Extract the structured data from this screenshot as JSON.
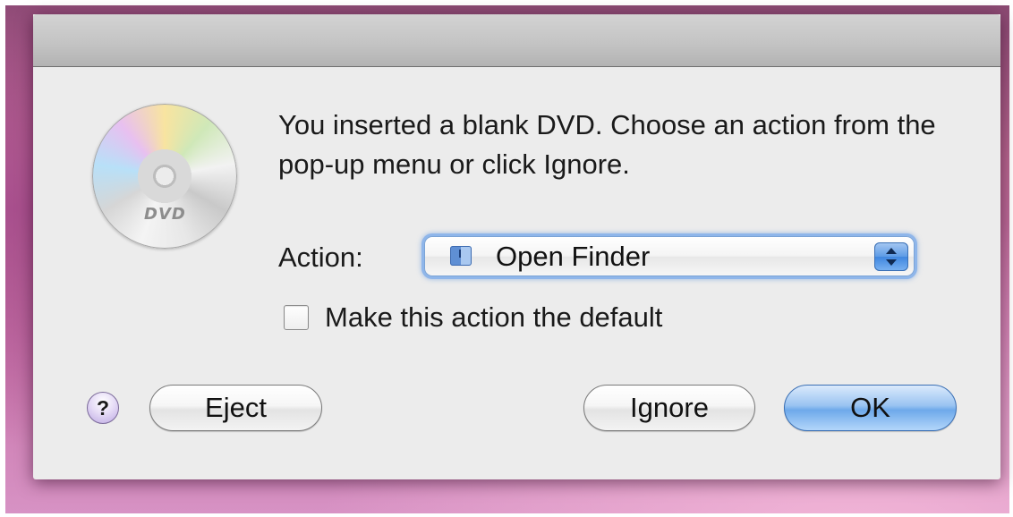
{
  "dialog": {
    "message": "You inserted a blank DVD. Choose an action from the pop-up menu or click Ignore.",
    "disc_icon": "dvd-disc-icon",
    "disc_text": "DVD",
    "action_label": "Action:",
    "action_popup": {
      "value": "Open Finder",
      "icon": "finder-icon"
    },
    "default_checkbox": {
      "label": "Make this action the default",
      "checked": false
    },
    "buttons": {
      "help": "?",
      "eject": "Eject",
      "ignore": "Ignore",
      "ok": "OK"
    }
  },
  "colors": {
    "dialog_background": "#ececec",
    "focus_ring": "#8fb6ea",
    "default_button": "#6ea9ea",
    "desktop": "#c773a8"
  }
}
